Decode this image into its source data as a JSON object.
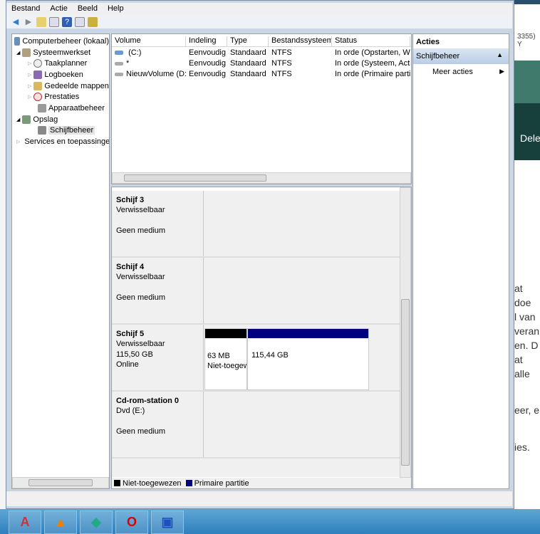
{
  "menu": [
    "Bestand",
    "Actie",
    "Beeld",
    "Help"
  ],
  "tree": {
    "root": "Computerbeheer (lokaal)",
    "systeemwerkset": "Systeemwerkset",
    "items": [
      "Taakplanner",
      "Logboeken",
      "Gedeelde mappen",
      "Prestaties",
      "Apparaatbeheer"
    ],
    "opslag": "Opslag",
    "schijfbeheer": "Schijfbeheer",
    "services": "Services en toepassingen"
  },
  "columns": [
    "Volume",
    "Indeling",
    "Type",
    "Bestandssysteem",
    "Status"
  ],
  "volumes": [
    {
      "volume": "(C:)",
      "indeling": "Eenvoudig",
      "type": "Standaard",
      "fs": "NTFS",
      "status": "In orde (Opstarten, Wi"
    },
    {
      "volume": "*",
      "indeling": "Eenvoudig",
      "type": "Standaard",
      "fs": "NTFS",
      "status": "In orde (Systeem, Acti"
    },
    {
      "volume": "NieuwVolume (D:)",
      "indeling": "Eenvoudig",
      "type": "Standaard",
      "fs": "NTFS",
      "status": "In orde (Primaire parti"
    }
  ],
  "disks": [
    {
      "name": "Schijf 3",
      "type": "Verwisselbaar",
      "line3": "",
      "line4": "Geen medium"
    },
    {
      "name": "Schijf 4",
      "type": "Verwisselbaar",
      "line3": "",
      "line4": "Geen medium"
    },
    {
      "name": "Schijf 5",
      "type": "Verwisselbaar",
      "line3": "115,50 GB",
      "line4": "Online",
      "partitions": [
        {
          "size": "63 MB",
          "label": "Niet-toegewezen"
        },
        {
          "size": "115,44 GB",
          "label": ""
        }
      ]
    },
    {
      "name": "Cd-rom-station 0",
      "type": "Dvd (E:)",
      "line3": "",
      "line4": "Geen medium"
    }
  ],
  "legend": [
    {
      "label": "Niet-toegewezen",
      "color": "#000000"
    },
    {
      "label": "Primaire partitie",
      "color": "#00007f"
    }
  ],
  "actions": {
    "title": "Acties",
    "section": "Schijfbeheer",
    "more": "Meer acties"
  },
  "background": {
    "top": "3355) Y",
    "button": "Dele",
    "lines": [
      "at doe",
      "l van",
      "veran",
      "en. D",
      "at alle",
      "eer, e",
      "ies."
    ]
  }
}
